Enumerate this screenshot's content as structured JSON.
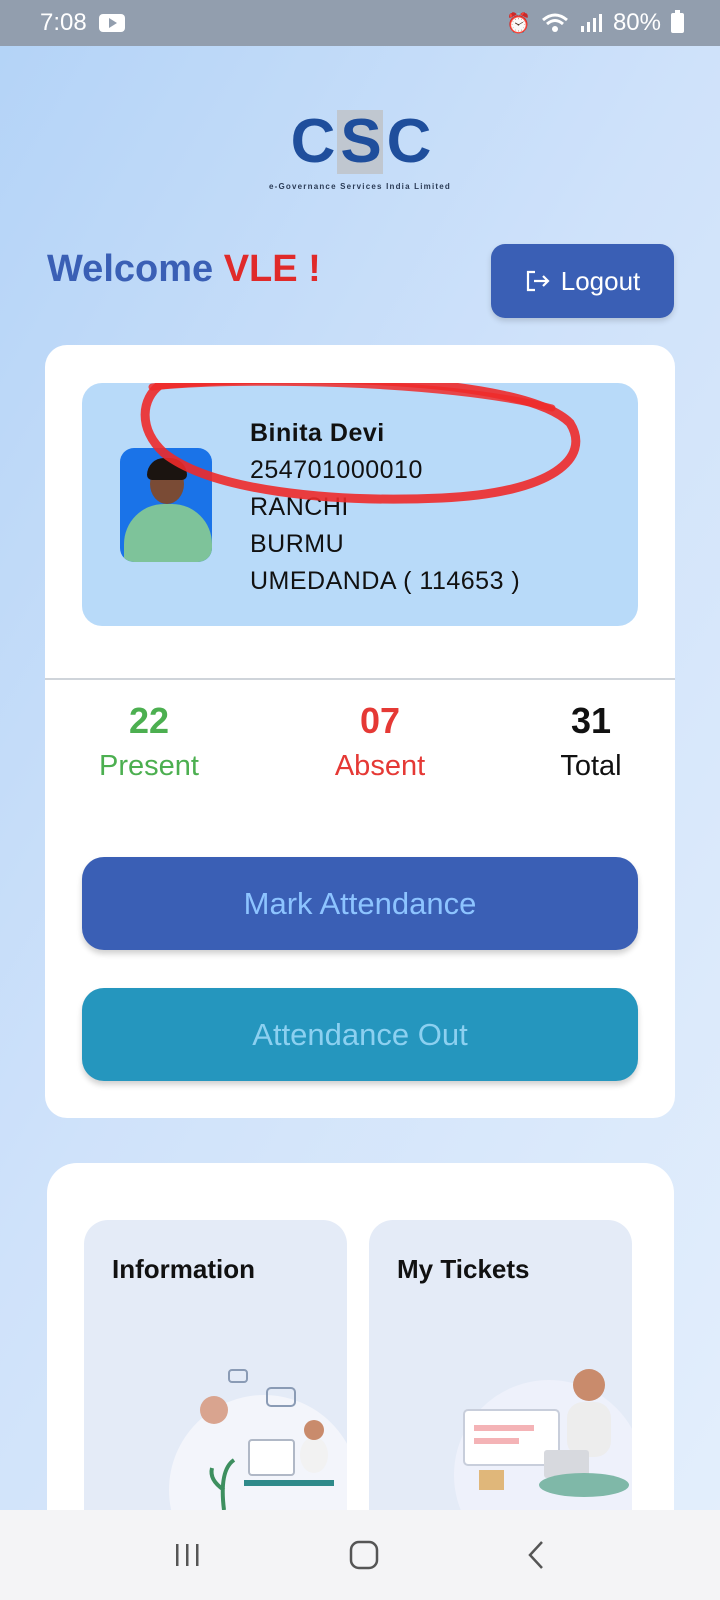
{
  "status_bar": {
    "time": "7:08",
    "battery": "80%",
    "icons": [
      "youtube-icon",
      "alarm-icon",
      "wifi-icon",
      "signal-icon",
      "battery-icon"
    ]
  },
  "logo": {
    "letters": [
      "C",
      "S",
      "C"
    ],
    "subtitle": "e-Governance Services India Limited"
  },
  "header": {
    "welcome_prefix": "Welcome",
    "welcome_name": "VLE !",
    "logout_label": "Logout",
    "welcome_color": "#3a5fb5",
    "name_color": "#e02a2a"
  },
  "profile": {
    "name": "Binita Devi",
    "id": "254701000010",
    "district": "RANCHI",
    "block": "BURMU",
    "panchayat": "UMEDANDA ( 114653 )"
  },
  "stats": {
    "present_value": "22",
    "present_label": "Present",
    "absent_value": "07",
    "absent_label": "Absent",
    "total_value": "31",
    "total_label": "Total"
  },
  "actions": {
    "mark_attendance": "Mark Attendance",
    "attendance_out": "Attendance Out"
  },
  "tiles": {
    "information": "Information",
    "my_tickets": "My Tickets"
  },
  "nav": {
    "recents_icon": "recents-icon",
    "home_icon": "home-icon",
    "back_icon": "back-icon"
  }
}
